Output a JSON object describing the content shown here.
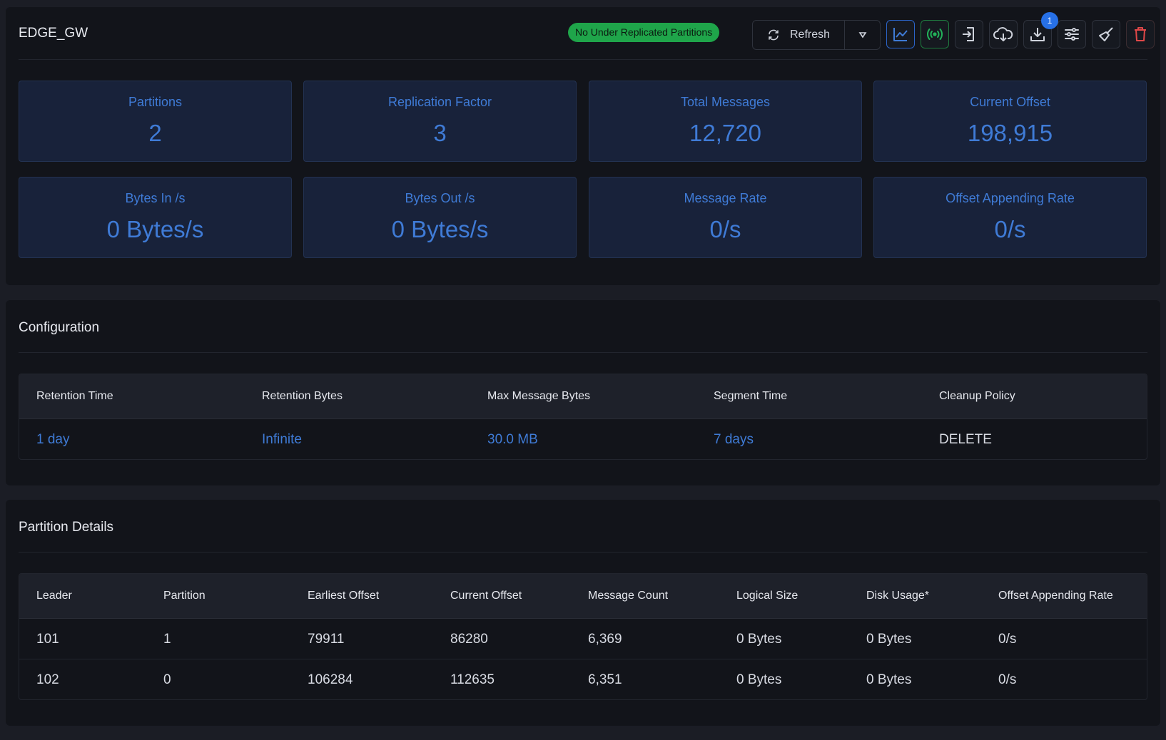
{
  "header": {
    "title": "EDGE_GW",
    "status_badge": "No Under Replicated Partitions",
    "refresh_label": "Refresh",
    "download_badge_count": "1",
    "icons": [
      "chart-icon",
      "broadcast-icon",
      "import-icon",
      "cloud-download-icon",
      "download-icon",
      "sliders-icon",
      "broom-icon",
      "trash-icon"
    ]
  },
  "stats": [
    {
      "label": "Partitions",
      "value": "2"
    },
    {
      "label": "Replication Factor",
      "value": "3"
    },
    {
      "label": "Total Messages",
      "value": "12,720"
    },
    {
      "label": "Current Offset",
      "value": "198,915"
    },
    {
      "label": "Bytes In /s",
      "value": "0 Bytes/s"
    },
    {
      "label": "Bytes Out /s",
      "value": "0 Bytes/s"
    },
    {
      "label": "Message Rate",
      "value": "0/s"
    },
    {
      "label": "Offset Appending Rate",
      "value": "0/s"
    }
  ],
  "configuration": {
    "title": "Configuration",
    "headers": [
      "Retention Time",
      "Retention Bytes",
      "Max Message Bytes",
      "Segment Time",
      "Cleanup Policy"
    ],
    "values": [
      "1 day",
      "Infinite",
      "30.0 MB",
      "7 days",
      "DELETE"
    ]
  },
  "partitions": {
    "title": "Partition Details",
    "headers": [
      "Leader",
      "Partition",
      "Earliest Offset",
      "Current Offset",
      "Message Count",
      "Logical Size",
      "Disk Usage*",
      "Offset Appending Rate"
    ],
    "rows": [
      [
        "101",
        "1",
        "79911",
        "86280",
        "6,369",
        "0 Bytes",
        "0 Bytes",
        "0/s"
      ],
      [
        "102",
        "0",
        "106284",
        "112635",
        "6,351",
        "0 Bytes",
        "0 Bytes",
        "0/s"
      ]
    ]
  },
  "colors": {
    "accent": "#3f7bd6",
    "success": "#1fa54a",
    "danger": "#e04848",
    "background": "#12141a"
  }
}
